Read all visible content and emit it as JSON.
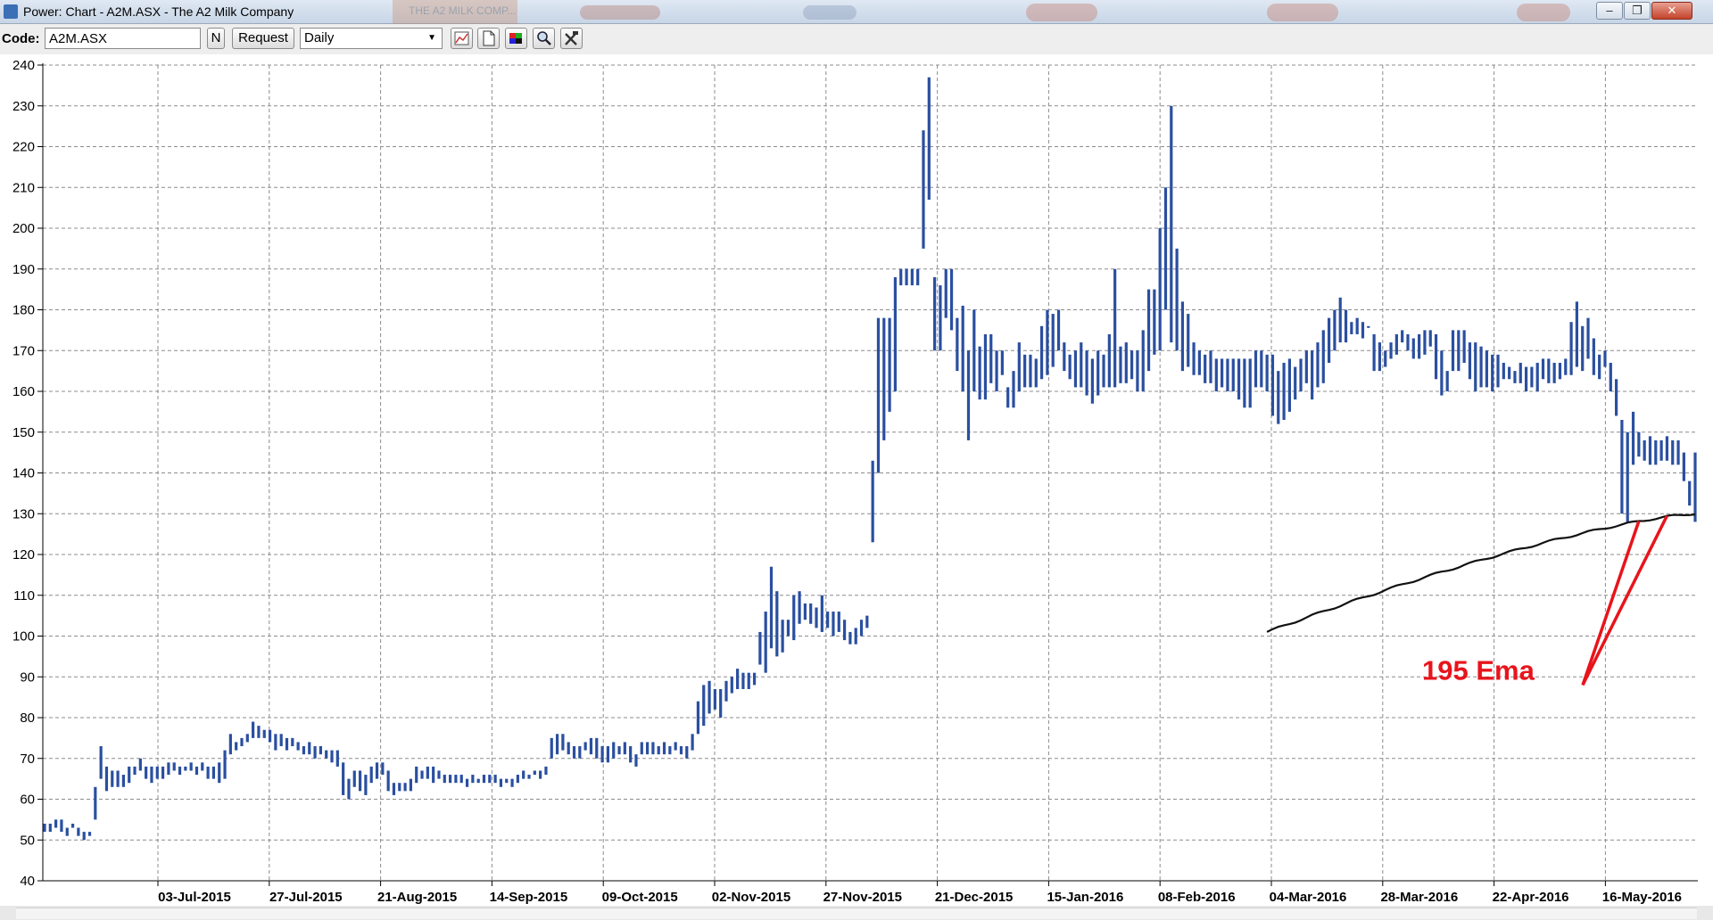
{
  "window": {
    "title": "Power: Chart - A2M.ASX - The A2 Milk Company",
    "background_tab": "THE A2 MILK COMP...",
    "controls": [
      "minimize",
      "restore",
      "close"
    ]
  },
  "toolbar": {
    "code_label": "Code:",
    "code_value": "A2M.ASX",
    "n_button": "N",
    "request_button": "Request",
    "period_select": "Daily",
    "icons": [
      "chart-style-icon",
      "page-icon",
      "color-palette-icon",
      "zoom-icon",
      "tools-icon"
    ]
  },
  "colors": {
    "bars": "#2a4fa0",
    "ema_line": "#111111",
    "annotation": "#e8141b",
    "grid": "#8c8c8c"
  },
  "chart_data": {
    "type": "ohlc",
    "ticker": "A2M.ASX",
    "ylim": [
      40,
      240
    ],
    "yticks": [
      40,
      50,
      60,
      70,
      80,
      90,
      100,
      110,
      120,
      130,
      140,
      150,
      160,
      170,
      180,
      190,
      200,
      210,
      220,
      230,
      240
    ],
    "xtick_labels": [
      "03-Jul-2015",
      "27-Jul-2015",
      "21-Aug-2015",
      "14-Sep-2015",
      "09-Oct-2015",
      "02-Nov-2015",
      "27-Nov-2015",
      "21-Dec-2015",
      "15-Jan-2016",
      "08-Feb-2016",
      "04-Mar-2016",
      "28-Mar-2016",
      "22-Apr-2016",
      "16-May-2016"
    ],
    "grid": true,
    "bars": [
      [
        52,
        54
      ],
      [
        52,
        54
      ],
      [
        53,
        55
      ],
      [
        52,
        55
      ],
      [
        51,
        53
      ],
      [
        53,
        54
      ],
      [
        51,
        53
      ],
      [
        50,
        52
      ],
      [
        51,
        52
      ],
      [
        55,
        63
      ],
      [
        65,
        73
      ],
      [
        62,
        68
      ],
      [
        63,
        67
      ],
      [
        63,
        67
      ],
      [
        63,
        66
      ],
      [
        64,
        68
      ],
      [
        66,
        68
      ],
      [
        67,
        70
      ],
      [
        65,
        68
      ],
      [
        64,
        68
      ],
      [
        65,
        68
      ],
      [
        65,
        68
      ],
      [
        66,
        69
      ],
      [
        67,
        69
      ],
      [
        66,
        68
      ],
      [
        67,
        68
      ],
      [
        67,
        69
      ],
      [
        66,
        68
      ],
      [
        67,
        69
      ],
      [
        65,
        68
      ],
      [
        65,
        68
      ],
      [
        64,
        69
      ],
      [
        65,
        72
      ],
      [
        71,
        76
      ],
      [
        72,
        74
      ],
      [
        73,
        75
      ],
      [
        74,
        76
      ],
      [
        75,
        79
      ],
      [
        75,
        78
      ],
      [
        75,
        77
      ],
      [
        74,
        77
      ],
      [
        72,
        76
      ],
      [
        73,
        76
      ],
      [
        72,
        75
      ],
      [
        73,
        75
      ],
      [
        72,
        74
      ],
      [
        71,
        73
      ],
      [
        71,
        74
      ],
      [
        70,
        73
      ],
      [
        71,
        73
      ],
      [
        70,
        72
      ],
      [
        69,
        72
      ],
      [
        68,
        72
      ],
      [
        61,
        69
      ],
      [
        60,
        65
      ],
      [
        63,
        67
      ],
      [
        62,
        67
      ],
      [
        61,
        66
      ],
      [
        64,
        68
      ],
      [
        65,
        69
      ],
      [
        66,
        69
      ],
      [
        62,
        67
      ],
      [
        61,
        64
      ],
      [
        62,
        64
      ],
      [
        62,
        64
      ],
      [
        62,
        65
      ],
      [
        64,
        68
      ],
      [
        65,
        67
      ],
      [
        65,
        68
      ],
      [
        64,
        68
      ],
      [
        65,
        67
      ],
      [
        64,
        66
      ],
      [
        64,
        66
      ],
      [
        64,
        66
      ],
      [
        64,
        66
      ],
      [
        63,
        65
      ],
      [
        64,
        66
      ],
      [
        64,
        65
      ],
      [
        64,
        66
      ],
      [
        64,
        66
      ],
      [
        64,
        66
      ],
      [
        63,
        65
      ],
      [
        64,
        65
      ],
      [
        63,
        65
      ],
      [
        64,
        66
      ],
      [
        65,
        67
      ],
      [
        65,
        66
      ],
      [
        66,
        67
      ],
      [
        65,
        67
      ],
      [
        66,
        68
      ],
      [
        70,
        75
      ],
      [
        71,
        76
      ],
      [
        72,
        76
      ],
      [
        71,
        74
      ],
      [
        70,
        73
      ],
      [
        70,
        73
      ],
      [
        72,
        74
      ],
      [
        71,
        75
      ],
      [
        70,
        75
      ],
      [
        69,
        73
      ],
      [
        69,
        73
      ],
      [
        70,
        74
      ],
      [
        71,
        73
      ],
      [
        71,
        74
      ],
      [
        69,
        73
      ],
      [
        68,
        71
      ],
      [
        71,
        74
      ],
      [
        71,
        74
      ],
      [
        71,
        74
      ],
      [
        71,
        73
      ],
      [
        71,
        74
      ],
      [
        71,
        73
      ],
      [
        72,
        74
      ],
      [
        71,
        73
      ],
      [
        70,
        73
      ],
      [
        72,
        76
      ],
      [
        76,
        84
      ],
      [
        78,
        88
      ],
      [
        81,
        89
      ],
      [
        82,
        87
      ],
      [
        80,
        87
      ],
      [
        84,
        89
      ],
      [
        86,
        90
      ],
      [
        87,
        92
      ],
      [
        87,
        91
      ],
      [
        87,
        91
      ],
      [
        88,
        91
      ],
      [
        93,
        101
      ],
      [
        91,
        106
      ],
      [
        97,
        117
      ],
      [
        95,
        111
      ],
      [
        96,
        104
      ],
      [
        100,
        104
      ],
      [
        99,
        110
      ],
      [
        103,
        111
      ],
      [
        104,
        108
      ],
      [
        103,
        108
      ],
      [
        102,
        107
      ],
      [
        101,
        110
      ],
      [
        102,
        106
      ],
      [
        100,
        106
      ],
      [
        101,
        106
      ],
      [
        99,
        104
      ],
      [
        98,
        101
      ],
      [
        98,
        102
      ],
      [
        100,
        104
      ],
      [
        102,
        105
      ],
      [
        123,
        143
      ],
      [
        140,
        178
      ],
      [
        148,
        178
      ],
      [
        155,
        178
      ],
      [
        160,
        188
      ],
      [
        186,
        190
      ],
      [
        186,
        190
      ],
      [
        186,
        190
      ],
      [
        186,
        190
      ],
      [
        195,
        224
      ],
      [
        207,
        237
      ],
      [
        170,
        188
      ],
      [
        170,
        186
      ],
      [
        178,
        190
      ],
      [
        175,
        190
      ],
      [
        165,
        178
      ],
      [
        160,
        181
      ],
      [
        148,
        170
      ],
      [
        160,
        180
      ],
      [
        158,
        171
      ],
      [
        158,
        174
      ],
      [
        162,
        174
      ],
      [
        160,
        170
      ],
      [
        164,
        170
      ],
      [
        156,
        161
      ],
      [
        156,
        165
      ],
      [
        160,
        172
      ],
      [
        161,
        169
      ],
      [
        161,
        169
      ],
      [
        161,
        168
      ],
      [
        163,
        176
      ],
      [
        164,
        180
      ],
      [
        166,
        179
      ],
      [
        170,
        180
      ],
      [
        165,
        172
      ],
      [
        163,
        169
      ],
      [
        161,
        170
      ],
      [
        161,
        172
      ],
      [
        159,
        170
      ],
      [
        157,
        168
      ],
      [
        159,
        170
      ],
      [
        161,
        169
      ],
      [
        161,
        174
      ],
      [
        161,
        190
      ],
      [
        162,
        171
      ],
      [
        162,
        172
      ],
      [
        163,
        170
      ],
      [
        160,
        170
      ],
      [
        160,
        175
      ],
      [
        165,
        185
      ],
      [
        169,
        185
      ],
      [
        170,
        200
      ],
      [
        180,
        210
      ],
      [
        172,
        230
      ],
      [
        170,
        195
      ],
      [
        165,
        182
      ],
      [
        166,
        179
      ],
      [
        164,
        172
      ],
      [
        164,
        170
      ],
      [
        162,
        169
      ],
      [
        162,
        170
      ],
      [
        160,
        168
      ],
      [
        161,
        168
      ],
      [
        160,
        168
      ],
      [
        160,
        168
      ],
      [
        158,
        168
      ],
      [
        156,
        168
      ],
      [
        156,
        168
      ],
      [
        161,
        170
      ],
      [
        161,
        170
      ],
      [
        160,
        169
      ],
      [
        154,
        169
      ],
      [
        152,
        165
      ],
      [
        153,
        167
      ],
      [
        155,
        168
      ],
      [
        158,
        166
      ],
      [
        160,
        168
      ],
      [
        162,
        170
      ],
      [
        158,
        170
      ],
      [
        161,
        172
      ],
      [
        162,
        175
      ],
      [
        167,
        178
      ],
      [
        170,
        180
      ],
      [
        172,
        183
      ],
      [
        172,
        180
      ],
      [
        174,
        177
      ],
      [
        174,
        178
      ],
      [
        173,
        177
      ],
      [
        176,
        176
      ],
      [
        165,
        174
      ],
      [
        165,
        172
      ],
      [
        166,
        170
      ],
      [
        168,
        172
      ],
      [
        169,
        174
      ],
      [
        172,
        175
      ],
      [
        170,
        174
      ],
      [
        168,
        173
      ],
      [
        168,
        174
      ],
      [
        169,
        175
      ],
      [
        171,
        175
      ],
      [
        163,
        174
      ],
      [
        159,
        170
      ],
      [
        160,
        165
      ],
      [
        165,
        175
      ],
      [
        165,
        175
      ],
      [
        167,
        175
      ],
      [
        163,
        172
      ],
      [
        160,
        172
      ],
      [
        161,
        171
      ],
      [
        161,
        170
      ],
      [
        160,
        169
      ],
      [
        161,
        169
      ],
      [
        163,
        167
      ],
      [
        163,
        166
      ],
      [
        162,
        165
      ],
      [
        162,
        167
      ],
      [
        160,
        166
      ],
      [
        161,
        166
      ],
      [
        160,
        167
      ],
      [
        163,
        168
      ],
      [
        162,
        168
      ],
      [
        162,
        167
      ],
      [
        163,
        167
      ],
      [
        164,
        168
      ],
      [
        164,
        177
      ],
      [
        166,
        182
      ],
      [
        165,
        176
      ],
      [
        168,
        178
      ],
      [
        164,
        173
      ],
      [
        163,
        169
      ],
      [
        166,
        170
      ],
      [
        160,
        167
      ],
      [
        154,
        163
      ],
      [
        130,
        153
      ],
      [
        128,
        150
      ],
      [
        142,
        155
      ],
      [
        144,
        150
      ],
      [
        143,
        148
      ],
      [
        142,
        149
      ],
      [
        142,
        148
      ],
      [
        143,
        148
      ],
      [
        143,
        149
      ],
      [
        142,
        148
      ],
      [
        142,
        148
      ],
      [
        138,
        145
      ],
      [
        132,
        138
      ],
      [
        128,
        145
      ]
    ],
    "ema_series": {
      "from_date": "04-Mar-2016",
      "start_value": 101,
      "end_value": 130
    },
    "annotation_text": "195 Ema"
  }
}
